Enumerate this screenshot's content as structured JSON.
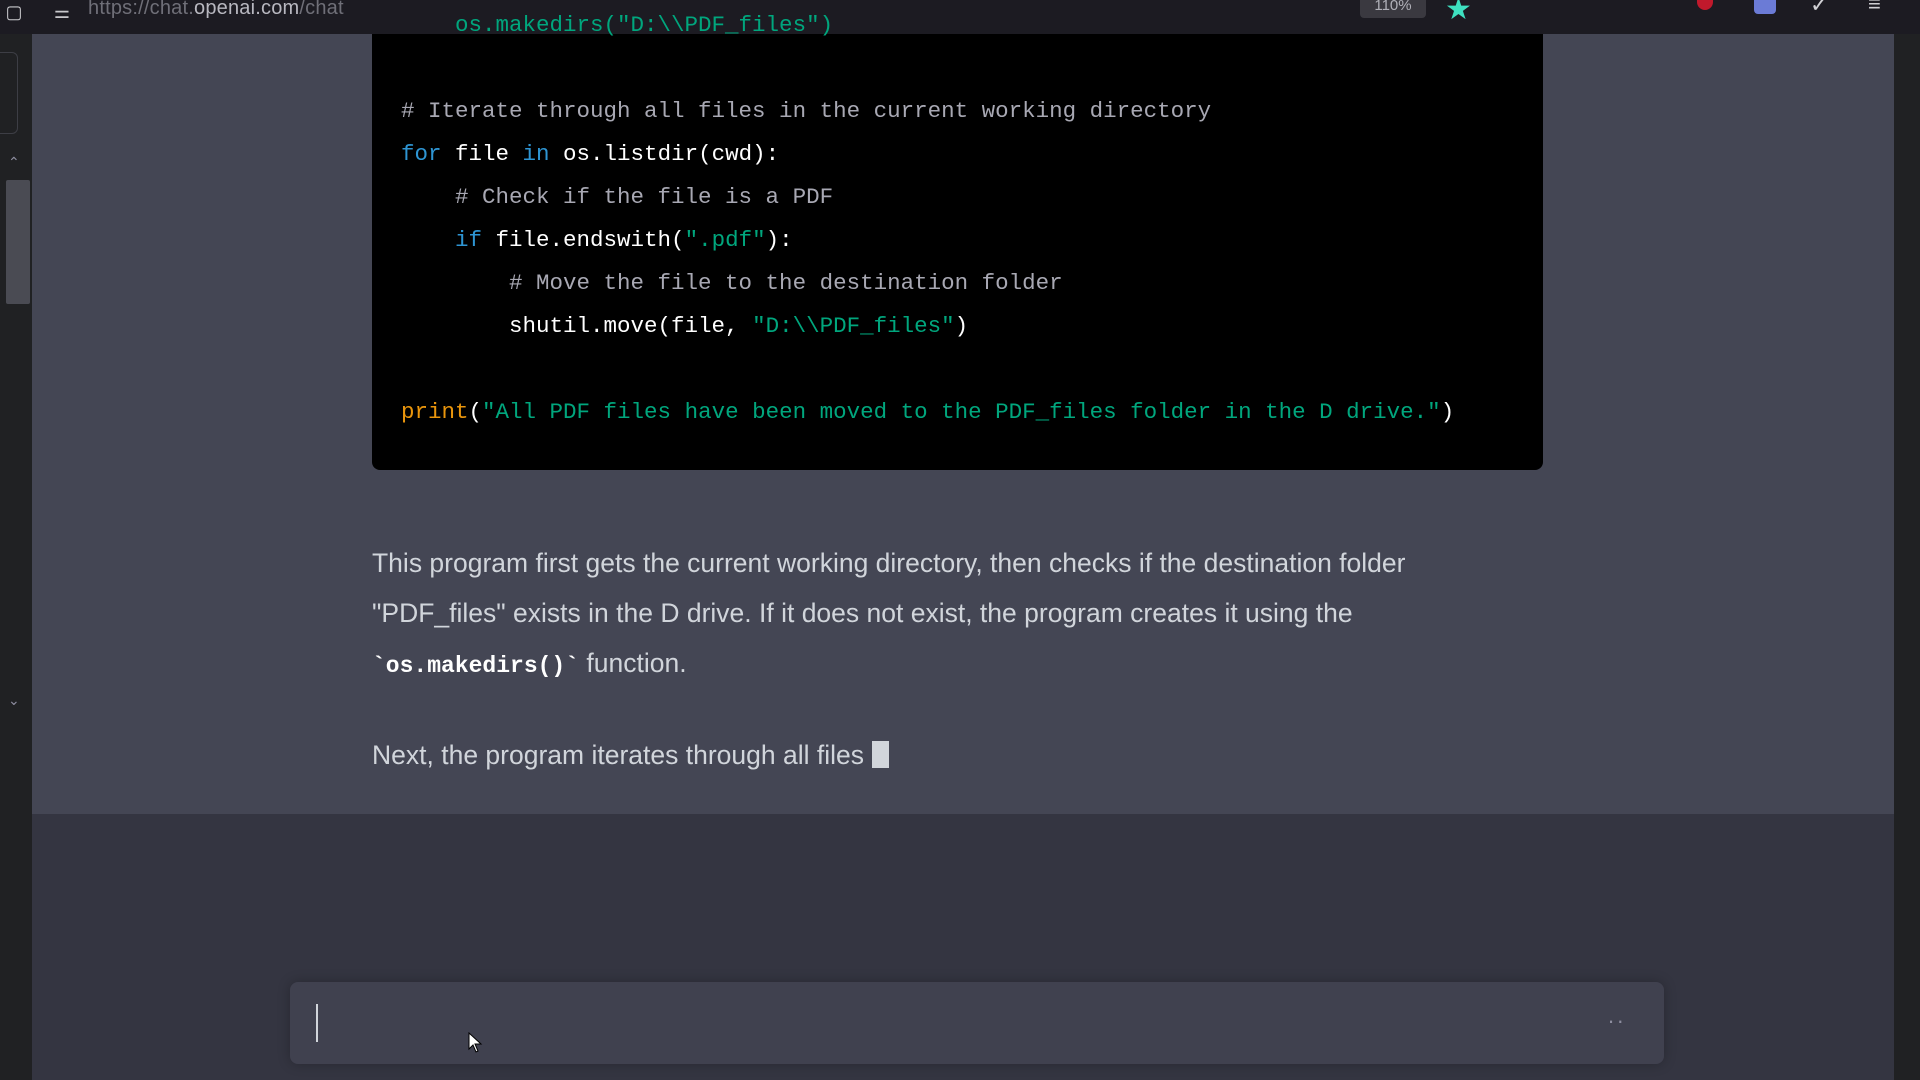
{
  "browser": {
    "url_scheme": "https://chat.",
    "url_host": "openai.com",
    "url_path": "/chat",
    "zoom": "110%"
  },
  "code": {
    "line_makedirs": "    os.makedirs(\"D:\\\\PDF_files\")",
    "comment_iterate": "# Iterate through all files in the current working directory",
    "for_kw": "for",
    "for_var": " file ",
    "in_kw": "in",
    "for_rest": " os.listdir(cwd):",
    "comment_check": "    # Check if the file is a PDF",
    "if_kw": "    if",
    "if_rest_a": " file.endswith(",
    "if_str": "\".pdf\"",
    "if_rest_b": "):",
    "comment_move": "        # Move the file to the destination folder",
    "move_a": "        shutil.move(file, ",
    "move_str": "\"D:\\\\PDF_files\"",
    "move_b": ")",
    "print_fn": "print",
    "print_open": "(",
    "print_str": "\"All PDF files have been moved to the PDF_files folder in the D drive.\"",
    "print_close": ")"
  },
  "response": {
    "p1_text_a": "This program first gets the current working directory, then checks if the destination folder \"PDF_files\" exists in the D drive. If it does not exist, the program creates it using the",
    "p1_code": "`os.makedirs()`",
    "p1_text_b": " function.",
    "p2_text": "Next, the program iterates through all files"
  },
  "input": {
    "placeholder": "",
    "more_icon": "··"
  }
}
